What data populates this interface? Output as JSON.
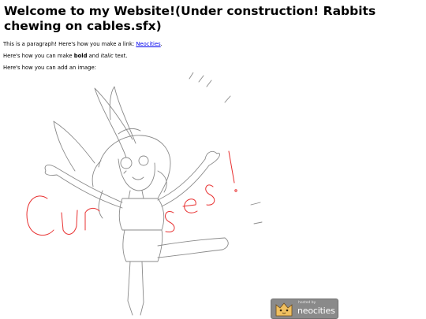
{
  "heading": "Welcome to my Website!(Under construction! Rabbits chewing on cables.sfx)",
  "para1": {
    "before": "This is a paragraph! Here's how you make a link: ",
    "link": "Neocities",
    "after": "."
  },
  "para2": {
    "before": "Here's how you can make ",
    "bold": "bold",
    "mid": " and ",
    "italic": "italic",
    "after": " text."
  },
  "para3": "Here's how you can add an image:",
  "image": {
    "handwriting": "Curses!",
    "handwriting_color": "#e83030"
  },
  "badge": {
    "small": "hosted by",
    "big": "neocities",
    "icon": "neocities-cat-icon"
  }
}
